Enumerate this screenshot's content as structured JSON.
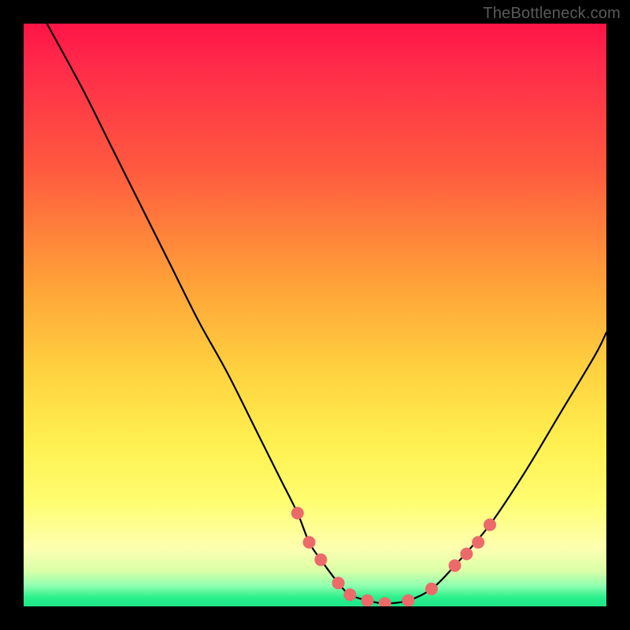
{
  "attribution": "TheBottleneck.com",
  "chart_data": {
    "type": "line",
    "title": "",
    "xlabel": "",
    "ylabel": "",
    "xlim": [
      0,
      100
    ],
    "ylim": [
      0,
      100
    ],
    "grid": false,
    "legend": false,
    "series": [
      {
        "name": "bottleneck-curve",
        "x": [
          4,
          10,
          15,
          20,
          25,
          30,
          35,
          40,
          44,
          47,
          49,
          51,
          54,
          56,
          59,
          62,
          66,
          70,
          74,
          80,
          86,
          92,
          98,
          100
        ],
        "values": [
          100,
          89,
          79,
          69,
          59,
          49,
          40,
          30,
          22,
          16,
          11,
          8,
          4,
          2,
          1,
          0.5,
          1,
          3,
          7,
          14,
          23,
          33,
          43,
          47
        ]
      }
    ],
    "markers": {
      "name": "highlight-points",
      "color": "#ec6a6a",
      "radius_px": 8,
      "x": [
        47,
        49,
        51,
        54,
        56,
        59,
        62,
        66,
        70,
        74,
        76,
        78,
        80
      ],
      "values": [
        16,
        11,
        8,
        4,
        2,
        1,
        0.5,
        1,
        3,
        7,
        9,
        11,
        14
      ]
    },
    "background": {
      "type": "vertical-gradient",
      "stops": [
        {
          "pos": 0,
          "color": "#ff1447"
        },
        {
          "pos": 25,
          "color": "#ff5a3f"
        },
        {
          "pos": 45,
          "color": "#ffa338"
        },
        {
          "pos": 72,
          "color": "#fff050"
        },
        {
          "pos": 90,
          "color": "#fdffb0"
        },
        {
          "pos": 100,
          "color": "#1de58a"
        }
      ]
    }
  }
}
